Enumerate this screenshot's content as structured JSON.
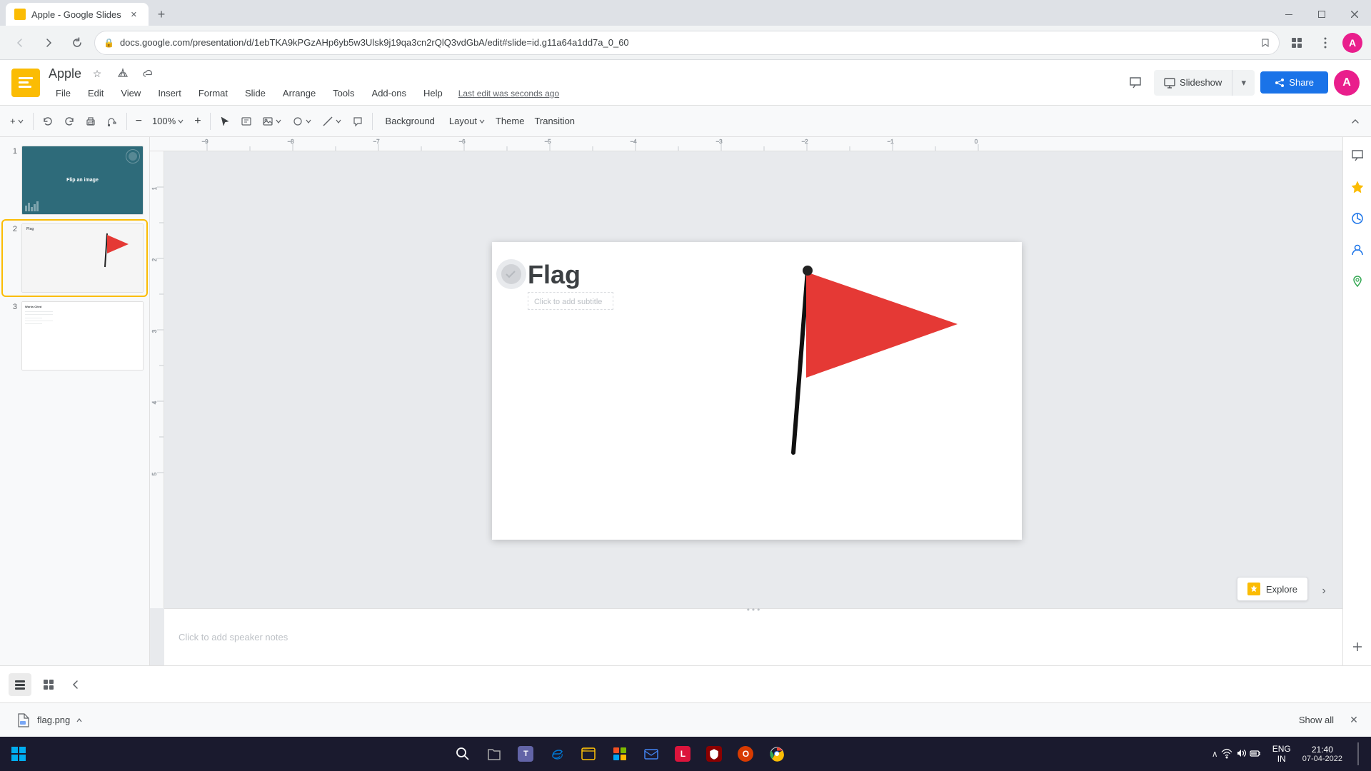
{
  "browser": {
    "tab_title": "Apple - Google Slides",
    "favicon": "🟡",
    "url": "docs.google.com/presentation/d/1ebTKA9kPGzAHp6yb5w3Ulsk9j19qa3cn2rQlQ3vdGbA/edit#slide=id.g11a64a1dd7a_0_60",
    "new_tab_label": "+",
    "window_controls": {
      "minimize": "—",
      "maximize": "□",
      "close": "✕"
    },
    "nav": {
      "back": "←",
      "forward": "→",
      "refresh": "↻"
    },
    "toolbar_actions": {
      "bookmark": "☆",
      "extensions": "🧩",
      "profile": "A"
    }
  },
  "app": {
    "logo_char": "✦",
    "title": "Apple",
    "last_edit": "Last edit was seconds ago",
    "menu": {
      "file": "File",
      "edit": "Edit",
      "view": "View",
      "insert": "Insert",
      "format": "Format",
      "slide": "Slide",
      "arrange": "Arrange",
      "tools": "Tools",
      "addons": "Add-ons",
      "help": "Help"
    },
    "header_right": {
      "comment_icon": "💬",
      "present_label": "Slideshow",
      "share_label": "Share",
      "lock_icon": "🔒"
    }
  },
  "toolbar": {
    "insert_btn": "+",
    "undo": "↩",
    "redo": "↪",
    "print": "🖨",
    "paint_format": "🎨",
    "zoom_out": "−",
    "zoom_in": "+",
    "zoom_level": "100%",
    "select": "↖",
    "text_box": "T",
    "image": "🖼",
    "shape": "◯",
    "line": "/",
    "comment": "💬",
    "background_label": "Background",
    "layout_label": "Layout",
    "theme_label": "Theme",
    "transition_label": "Transition"
  },
  "slides": {
    "list": [
      {
        "number": "1",
        "title": "Flip an image",
        "bg": "#2e6b7a"
      },
      {
        "number": "2",
        "title": "Flag",
        "bg": "#f5f5f5",
        "active": true
      },
      {
        "number": "3",
        "title": "Works Cited",
        "bg": "#ffffff"
      }
    ]
  },
  "canvas": {
    "slide_title": "Flag",
    "slide_subtitle": "Click to add subtitle",
    "notes_placeholder": "Click to add speaker notes"
  },
  "sidebar_right": {
    "icons": [
      "💬",
      "⭐",
      "🔵",
      "👤",
      "📍"
    ],
    "expand": "+"
  },
  "explore": {
    "label": "Explore",
    "expand_label": ">"
  },
  "bottom_bar": {
    "list_view_icon": "☰",
    "grid_view_icon": "⊞",
    "collapse_icon": "‹"
  },
  "file_bar": {
    "filename": "flag.png",
    "close": "✕",
    "show_all": "Show all",
    "chevron_up": "∧",
    "file_icon": "🖼"
  },
  "taskbar": {
    "start_icon": "⊞",
    "items": [
      {
        "icon": "🔍",
        "name": "search"
      },
      {
        "icon": "🗂",
        "name": "file-explorer-alt"
      },
      {
        "icon": "💬",
        "name": "teams"
      },
      {
        "icon": "🌐",
        "name": "edge"
      },
      {
        "icon": "📁",
        "name": "file-explorer"
      },
      {
        "icon": "🪟",
        "name": "microsoft-store"
      },
      {
        "icon": "📧",
        "name": "mail"
      },
      {
        "icon": "L",
        "name": "lens"
      },
      {
        "icon": "🛡",
        "name": "security"
      },
      {
        "icon": "🏢",
        "name": "office"
      },
      {
        "icon": "🔴",
        "name": "chrome"
      }
    ],
    "sys_tray": {
      "up_arrow": "∧",
      "network": "📶",
      "volume": "🔊",
      "battery": "🔋",
      "time": "21:40",
      "date": "07-04-2022",
      "lang": "ENG\nIN"
    }
  }
}
